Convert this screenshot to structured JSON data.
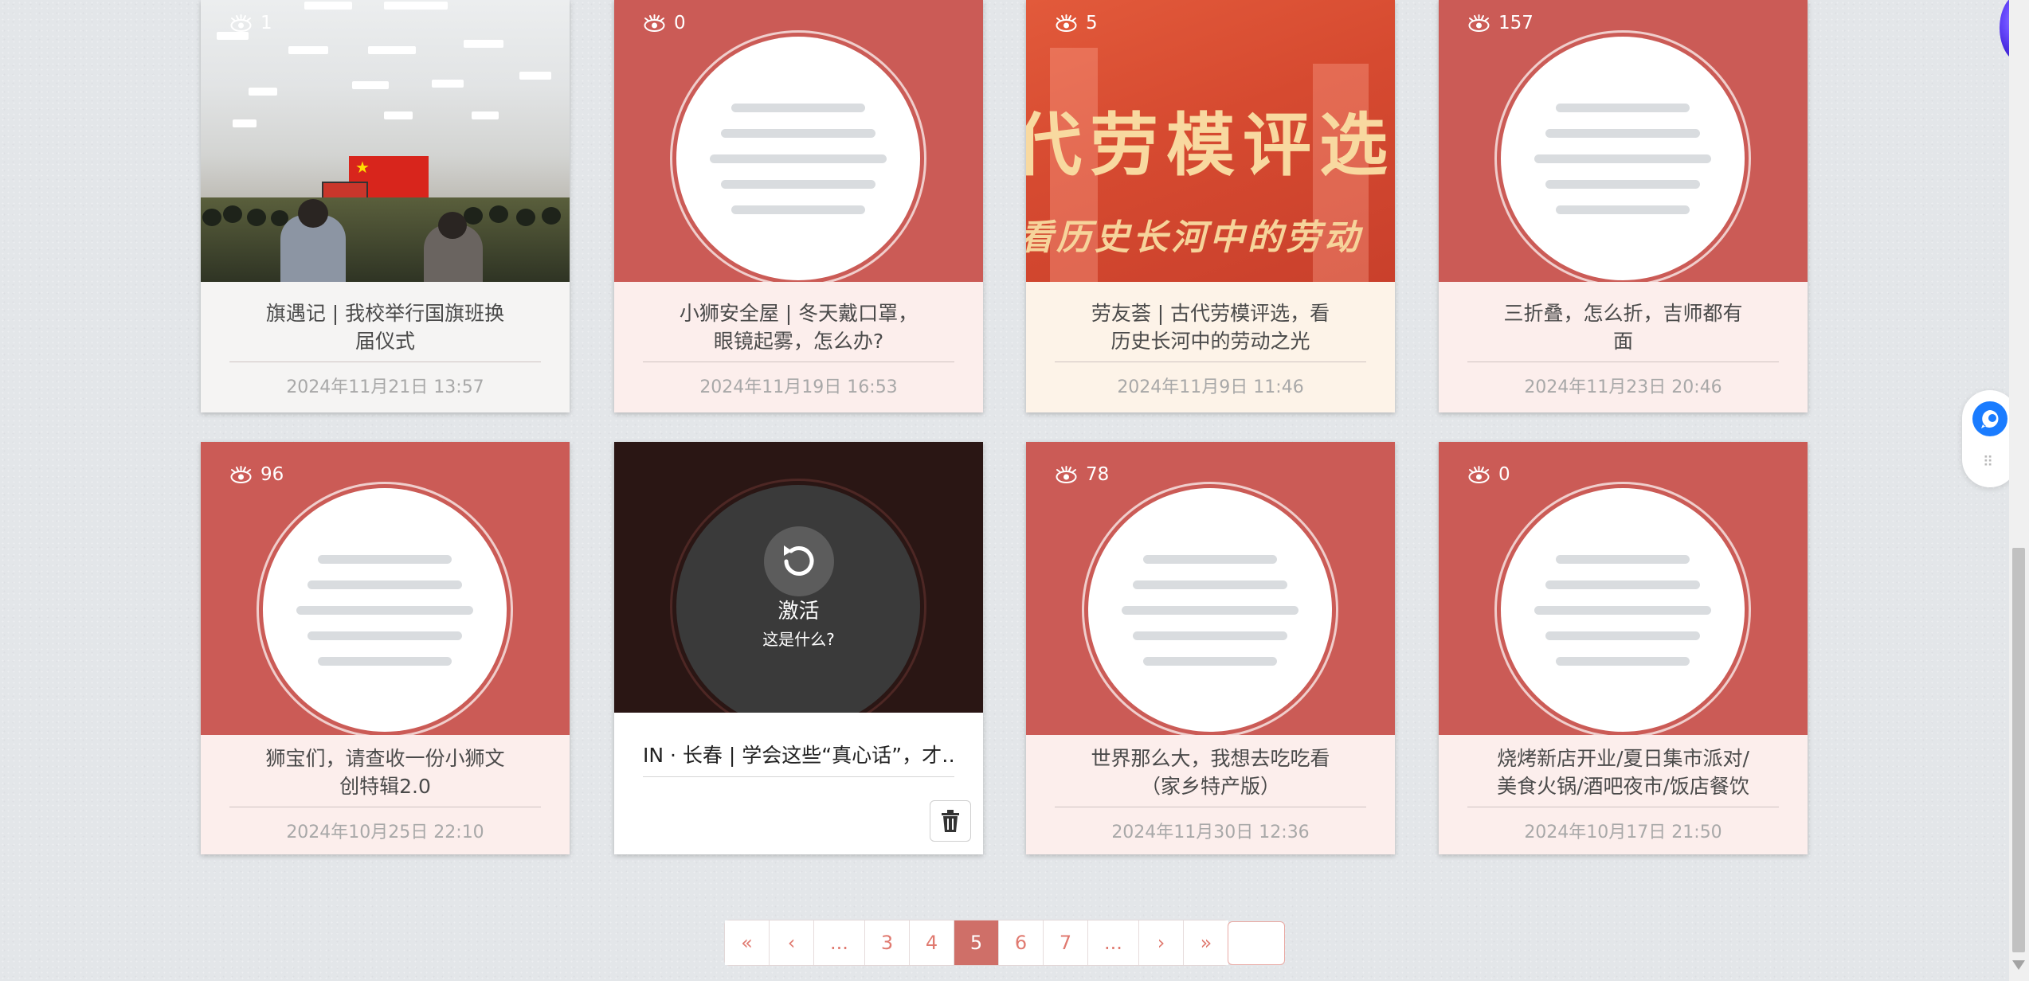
{
  "cards": [
    {
      "views": "1",
      "title": "旗遇记 | 我校举行国旗班换届仪式",
      "title_l1": "旗遇记 | 我校举行国旗班换",
      "title_l2": "届仪式",
      "date": "2024年11月21日 13:57",
      "cover": "photo"
    },
    {
      "views": "0",
      "title_l1": "小狮安全屋 | 冬天戴口罩，",
      "title_l2": "眼镜起雾，怎么办?",
      "date": "2024年11月19日 16:53",
      "cover": "placeholder"
    },
    {
      "views": "5",
      "title_l1": "劳友荟 | 古代劳模评选，看",
      "title_l2": "历史长河中的劳动之光",
      "date": "2024年11月9日 11:46",
      "cover": "banner",
      "banner_line1": "代劳模评选",
      "banner_line2": "看历史长河中的劳动"
    },
    {
      "views": "157",
      "title_l1": "三折叠，怎么折，吉师都有",
      "title_l2": "面",
      "date": "2024年11月23日 20:46",
      "cover": "placeholder"
    },
    {
      "views": "96",
      "title_l1": "狮宝们，请查收一份小狮文",
      "title_l2": "创特辑2.0",
      "date": "2024年10月25日 22:10",
      "cover": "placeholder"
    },
    {
      "inactive": true,
      "activate_label": "激活",
      "whatis_label": "这是什么?",
      "title": "IN · 长春 | 学会这些“真心话”，才…"
    },
    {
      "views": "78",
      "title_l1": "世界那么大，我想去吃吃看",
      "title_l2": "（家乡特产版）",
      "date": "2024年11月30日 12:36",
      "cover": "placeholder"
    },
    {
      "views": "0",
      "title_l1": "烧烤新店开业/夏日集市派对/",
      "title_l2": "美食火锅/酒吧夜市/饭店餐饮",
      "date": "2024年10月17日 21:50",
      "cover": "placeholder"
    }
  ],
  "pagination": {
    "first": "«",
    "prev": "‹",
    "ellipsis_left": "...",
    "pages": [
      "3",
      "4",
      "5",
      "6",
      "7"
    ],
    "current": "5",
    "ellipsis_right": "...",
    "next": "›",
    "last": "»"
  },
  "colors": {
    "card_red": "#cb5b56",
    "card_info_bg": "#f9eceb",
    "pager_active": "#cf6f68",
    "pager_text": "#e07a70",
    "float_icon": "#1a7cff"
  },
  "icons": [
    "eye-icon",
    "reload-icon",
    "trash-icon",
    "chat-bubble-icon",
    "drag-grip-icon"
  ]
}
